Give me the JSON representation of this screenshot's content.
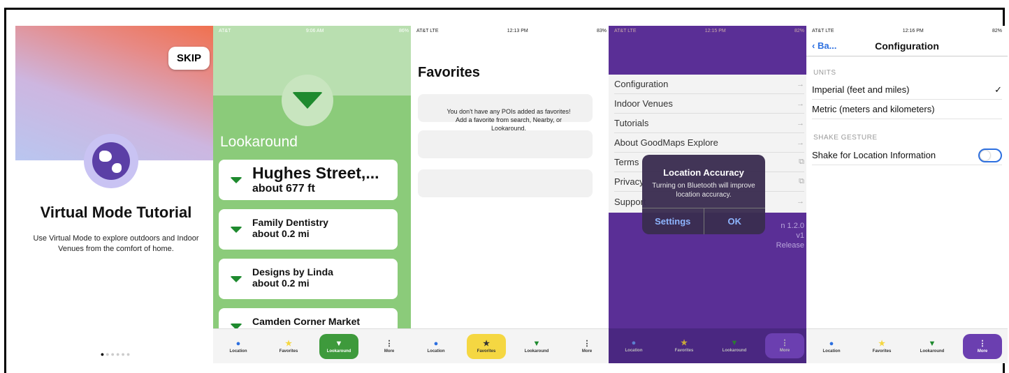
{
  "screens": {
    "s1": {
      "skip": "SKIP",
      "title": "Virtual Mode Tutorial",
      "description": "Use Virtual Mode to explore outdoors and Indoor Venues from the comfort of home.",
      "page_index": 1,
      "page_count": 6
    },
    "s2": {
      "status_carrier": "AT&T",
      "status_time": "9:06 AM",
      "status_battery": "86%",
      "heading": "Lookaround",
      "places": [
        {
          "name": "Hughes Street,...",
          "distance": "about 677 ft"
        },
        {
          "name": "Family Dentistry",
          "distance": "about 0.2 mi"
        },
        {
          "name": "Designs by Linda",
          "distance": "about 0.2 mi"
        },
        {
          "name": "Camden Corner Market",
          "distance": ""
        }
      ]
    },
    "s3": {
      "status_carrier": "AT&T LTE",
      "status_time": "12:13 PM",
      "status_battery": "83%",
      "heading": "Favorites",
      "empty_message": "You don't have any POIs added as favorites! Add a favorite from search, Nearby, or Lookaround."
    },
    "s4": {
      "status_carrier": "AT&T LTE",
      "status_time": "12:15 PM",
      "status_battery": "82%",
      "menu": [
        "Configuration",
        "Indoor Venues",
        "Tutorials",
        "About GoodMaps Explore",
        "Terms",
        "Privacy",
        "Support"
      ],
      "version_line1": "n 1.2.0",
      "version_line2": "v1",
      "version_line3": "Release",
      "alert_title": "Location Accuracy",
      "alert_message": "Turning on Bluetooth will improve location accuracy.",
      "alert_settings": "Settings",
      "alert_ok": "OK"
    },
    "s5": {
      "status_carrier": "AT&T LTE",
      "status_time": "12:16 PM",
      "status_battery": "82%",
      "back": "Ba...",
      "title": "Configuration",
      "units_header": "UNITS",
      "imperial": "Imperial (feet and miles)",
      "metric": "Metric (meters and kilometers)",
      "shake_header": "SHAKE GESTURE",
      "shake_label": "Shake for Location Information",
      "shake_enabled": false
    }
  },
  "tabs": {
    "location": "Location",
    "favorites": "Favorites",
    "lookaround": "Lookaround",
    "more": "More"
  },
  "colors": {
    "green": "#8bcb7a",
    "purple": "#5a2f96",
    "yellow": "#f5d742",
    "blue": "#2c6fe0"
  }
}
